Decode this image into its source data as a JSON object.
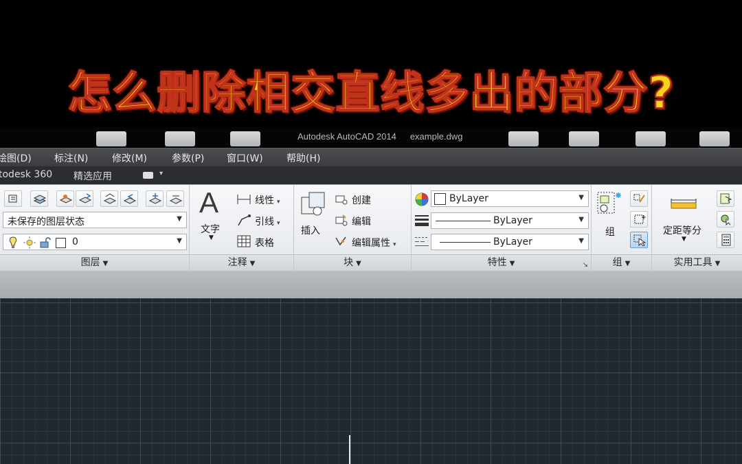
{
  "banner": {
    "title": "怎么删除相交直线多出的部分?"
  },
  "window": {
    "app": "Autodesk AutoCAD 2014",
    "file": "example.dwg"
  },
  "menu": [
    "绘图(D)",
    "标注(N)",
    "修改(M)",
    "参数(P)",
    "窗口(W)",
    "帮助(H)"
  ],
  "tabs": [
    "todesk 360",
    "精选应用"
  ],
  "ribbon": {
    "layers": {
      "state_combo": "未保存的图层状态",
      "layer_combo": "0",
      "footer": "图层"
    },
    "annotation": {
      "text_label": "文字",
      "linear": "线性",
      "leader": "引线",
      "table": "表格",
      "footer": "注释"
    },
    "block": {
      "insert": "插入",
      "create": "创建",
      "edit": "编辑",
      "edit_attr": "编辑属性",
      "footer": "块"
    },
    "properties": {
      "color": "ByLayer",
      "lineweight": "ByLayer",
      "linetype": "ByLayer",
      "footer": "特性"
    },
    "group": {
      "label": "组",
      "footer": "组"
    },
    "utilities": {
      "measure": "定距等分",
      "footer": "实用工具"
    }
  },
  "colors": {
    "banner_text": "#f7d51f",
    "banner_outline": "#c0321a",
    "canvas_bg": "#212830"
  }
}
